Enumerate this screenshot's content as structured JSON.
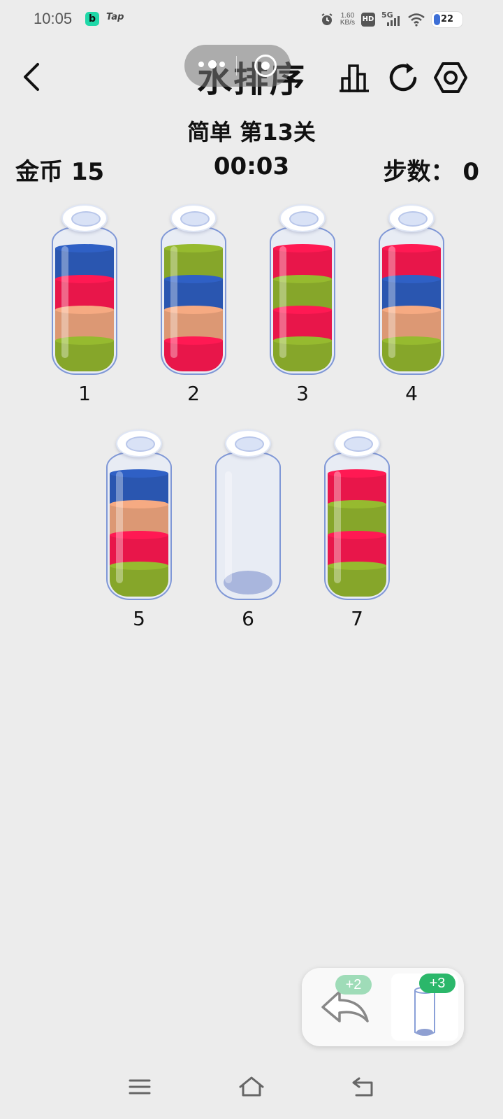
{
  "status_bar": {
    "time": "10:05",
    "app_badge": "b",
    "app_label": "Tap",
    "net_speed_value": "1.60",
    "net_speed_unit": "KB/s",
    "hd": "HD",
    "network": "5G",
    "battery_level": "22"
  },
  "header": {
    "title": "水排序",
    "level": "简单 第13关",
    "coins": "金币 15",
    "timer": "00:03",
    "steps": "步数： 0"
  },
  "colors": {
    "blue": "#2a56b0",
    "red": "#e8164a",
    "orange": "#dc9874",
    "green": "#86a62a",
    "accent_green": "#2bb76a",
    "light_green_badge": "#9fdcb8"
  },
  "bottles": [
    {
      "label": "1",
      "layers_top_to_bottom": [
        "blue",
        "red",
        "orange",
        "green"
      ]
    },
    {
      "label": "2",
      "layers_top_to_bottom": [
        "green",
        "blue",
        "orange",
        "red"
      ]
    },
    {
      "label": "3",
      "layers_top_to_bottom": [
        "red",
        "green",
        "red",
        "green"
      ]
    },
    {
      "label": "4",
      "layers_top_to_bottom": [
        "red",
        "blue",
        "orange",
        "green"
      ]
    },
    {
      "label": "5",
      "layers_top_to_bottom": [
        "blue",
        "orange",
        "red",
        "green"
      ]
    },
    {
      "label": "6",
      "layers_top_to_bottom": []
    },
    {
      "label": "7",
      "layers_top_to_bottom": [
        "red",
        "green",
        "red",
        "green"
      ]
    }
  ],
  "tools": {
    "undo_badge": "+2",
    "add_bottle_badge": "+3"
  },
  "nav": {
    "icons": [
      "menu-icon",
      "home-icon",
      "back-icon"
    ]
  }
}
